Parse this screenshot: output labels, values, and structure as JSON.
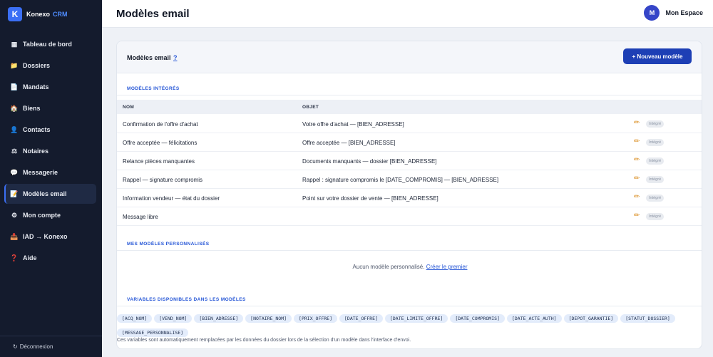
{
  "brand": {
    "logo_letter": "K",
    "name": "Konexo",
    "tag": "CRM"
  },
  "sidebar": {
    "items": [
      {
        "icon": "▦",
        "label": "Tableau de bord",
        "active": false
      },
      {
        "icon": "📁",
        "label": "Dossiers",
        "active": false
      },
      {
        "icon": "📄",
        "label": "Mandats",
        "active": false
      },
      {
        "icon": "🏠",
        "label": "Biens",
        "active": false
      },
      {
        "icon": "👤",
        "label": "Contacts",
        "active": false
      },
      {
        "icon": "⚖",
        "label": "Notaires",
        "active": false
      },
      {
        "icon": "💬",
        "label": "Messagerie",
        "active": false
      },
      {
        "icon": "📝",
        "label": "Modèles email",
        "active": true
      },
      {
        "icon": "⚙",
        "label": "Mon compte",
        "active": false
      },
      {
        "icon": "📥",
        "label": "IAD → Konexo",
        "active": false
      },
      {
        "icon": "❓",
        "label": "Aide",
        "active": false
      }
    ],
    "logout_icon": "↻",
    "logout_label": "Déconnexion"
  },
  "header": {
    "title": "Modèles email",
    "avatar_letter": "M",
    "account_name": "Mon Espace"
  },
  "card": {
    "title": "Modèles email",
    "help": "?",
    "new_button": "+ Nouveau modèle",
    "builtin_section": "MODÈLES INTÉGRÉS",
    "columns": {
      "name": "NOM",
      "subject": "OBJET"
    },
    "rows": [
      {
        "name": "Confirmation de l'offre d'achat",
        "subject": "Votre offre d'achat — [BIEN_ADRESSE]",
        "badge": "Intégré"
      },
      {
        "name": "Offre acceptée — félicitations",
        "subject": "Offre acceptée — [BIEN_ADRESSE]",
        "badge": "Intégré"
      },
      {
        "name": "Relance pièces manquantes",
        "subject": "Documents manquants — dossier [BIEN_ADRESSE]",
        "badge": "Intégré"
      },
      {
        "name": "Rappel — signature compromis",
        "subject": "Rappel : signature compromis le [DATE_COMPROMIS] — [BIEN_ADRESSE]",
        "badge": "Intégré"
      },
      {
        "name": "Information vendeur — état du dossier",
        "subject": "Point sur votre dossier de vente — [BIEN_ADRESSE]",
        "badge": "Intégré"
      },
      {
        "name": "Message libre",
        "subject": "",
        "badge": "Intégré"
      }
    ],
    "custom_section": "MES MODÈLES PERSONNALISÉS",
    "empty_text": "Aucun modèle personnalisé.",
    "empty_link": "Créer le premier",
    "variables_section": "VARIABLES DISPONIBLES DANS LES MODÈLES",
    "variables": [
      "[ACQ_NOM]",
      "[VEND_NOM]",
      "[BIEN_ADRESSE]",
      "[NOTAIRE_NOM]",
      "[PRIX_OFFRE]",
      "[DATE_OFFRE]",
      "[DATE_LIMITE_OFFRE]",
      "[DATE_COMPROMIS]",
      "[DATE_ACTE_AUTH]",
      "[DEPOT_GARANTIE]",
      "[STATUT_DOSSIER]",
      "[MESSAGE_PERSONNALISE]"
    ],
    "note": "Ces variables sont automatiquement remplacées par les données du dossier lors de la sélection d'un modèle dans l'interface d'envoi."
  }
}
